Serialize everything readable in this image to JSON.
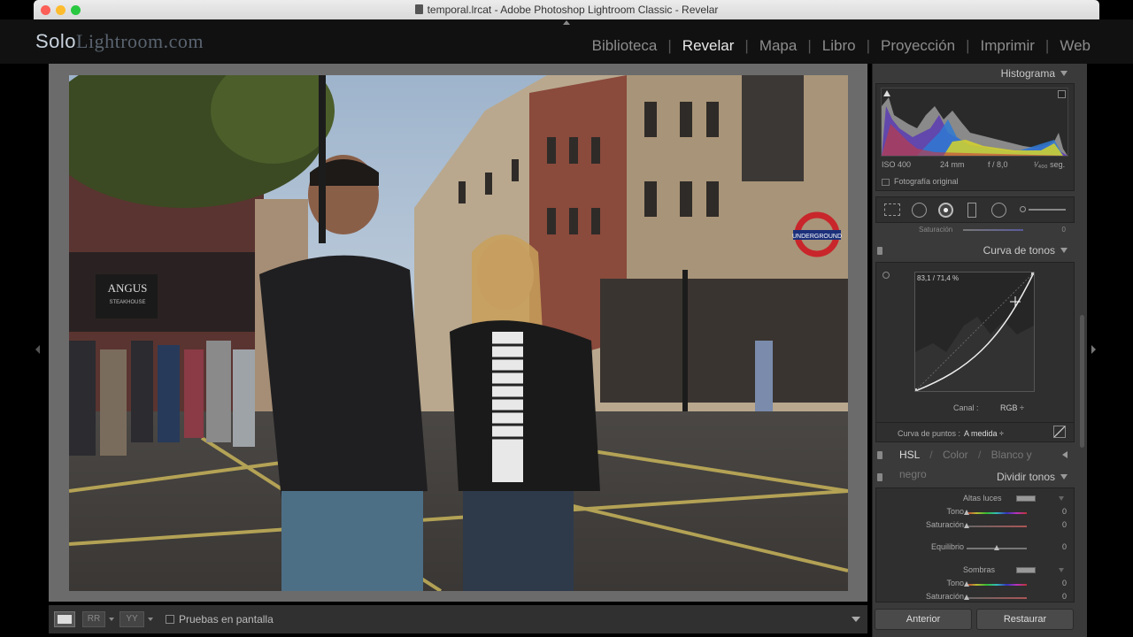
{
  "window": {
    "title": "temporal.lrcat - Adobe Photoshop Lightroom Classic - Revelar"
  },
  "logo": {
    "part1": "Solo",
    "part2": "Lightroom.com"
  },
  "modules": [
    {
      "label": "Biblioteca",
      "active": false
    },
    {
      "label": "Revelar",
      "active": true
    },
    {
      "label": "Mapa",
      "active": false
    },
    {
      "label": "Libro",
      "active": false
    },
    {
      "label": "Proyección",
      "active": false
    },
    {
      "label": "Imprimir",
      "active": false
    },
    {
      "label": "Web",
      "active": false
    }
  ],
  "photo": {
    "shop_sign": "ANGUS",
    "shop_sign_sub": "STEAKHOUSE",
    "roundel": "UNDERGROUND"
  },
  "histogram": {
    "title": "Histograma",
    "iso": "ISO 400",
    "focal": "24 mm",
    "aperture": "f / 8,0",
    "shutter": "¹⁄₄₀₀ seg.",
    "original_label": "Fotografía original"
  },
  "partial_row": {
    "label": "Saturación",
    "value": "0"
  },
  "tone_curve": {
    "title": "Curva de tonos",
    "readout": "83,1 / 71,4 %",
    "channel_label": "Canal :",
    "channel_value": "RGB ÷",
    "points_label": "Curva de puntos :",
    "points_value": "A medida ÷"
  },
  "hsl": {
    "tabs": [
      "HSL",
      "Color",
      "Blanco y negro"
    ],
    "separator": "/"
  },
  "split_toning": {
    "title": "Dividir tonos",
    "highlights_label": "Altas luces",
    "rows": [
      {
        "label": "Tono",
        "value": "0"
      },
      {
        "label": "Saturación",
        "value": "0"
      }
    ],
    "balance": {
      "label": "Equilibrio",
      "value": "0"
    },
    "shadows_label": "Sombras",
    "shadow_rows": [
      {
        "label": "Tono",
        "value": "0"
      },
      {
        "label": "Saturación",
        "value": "0"
      }
    ]
  },
  "toolbar": {
    "softproof_label": "Pruebas en pantalla",
    "view_yy": "YY",
    "view_rr": "RR"
  },
  "buttons": {
    "previous": "Anterior",
    "reset": "Restaurar"
  }
}
